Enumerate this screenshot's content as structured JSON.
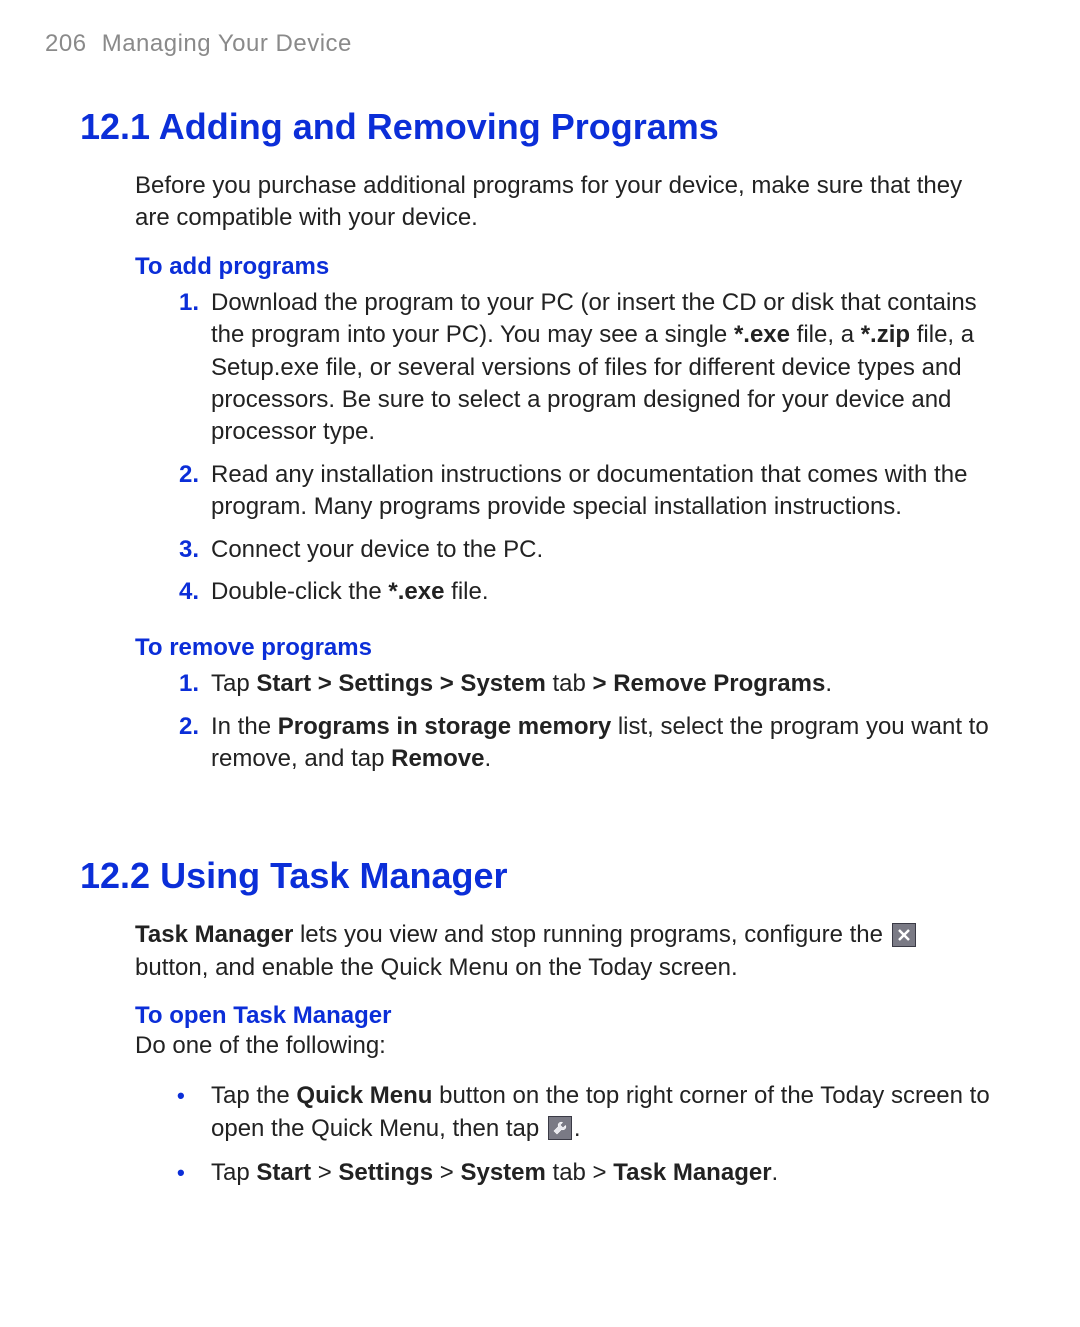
{
  "header": {
    "page_number": "206",
    "running_title": "Managing Your Device"
  },
  "section_12_1": {
    "heading": "12.1  Adding and Removing Programs",
    "intro": "Before you purchase additional programs for your device, make sure that they are compatible with your device.",
    "add": {
      "subhead": "To add programs",
      "steps": {
        "s1_a": "Download the program to your PC (or insert the CD or disk that contains the program into your PC). You may see a single ",
        "s1_b": "*.exe",
        "s1_c": " file, a ",
        "s1_d": "*.zip",
        "s1_e": " file, a Setup.exe file, or several versions of files for different device types and processors. Be sure to select a program designed for your device and processor type.",
        "s2": "Read any installation instructions or documentation that comes with the program. Many programs provide special installation instructions.",
        "s3": "Connect your device to the PC.",
        "s4_a": "Double-click the ",
        "s4_b": "*.exe",
        "s4_c": " file."
      }
    },
    "remove": {
      "subhead": "To remove programs",
      "steps": {
        "s1_a": "Tap ",
        "s1_b": "Start > Settings > System",
        "s1_c": " tab ",
        "s1_d": "> Remove Programs",
        "s1_e": ".",
        "s2_a": "In the ",
        "s2_b": "Programs in storage memory",
        "s2_c": " list, select the program you want to remove, and tap ",
        "s2_d": "Remove",
        "s2_e": "."
      }
    }
  },
  "section_12_2": {
    "heading": "12.2  Using Task Manager",
    "intro": {
      "a": "Task Manager",
      "b": " lets you view and stop running programs, configure the ",
      "c": " button, and enable the Quick Menu on the Today screen."
    },
    "open": {
      "subhead": "To open Task Manager",
      "lead": "Do one of the following:",
      "bullets": {
        "b1_a": "Tap the ",
        "b1_b": "Quick Menu",
        "b1_c": " button on the top right corner of the Today screen to open the Quick Menu, then tap ",
        "b1_d": ".",
        "b2_a": "Tap ",
        "b2_b": "Start",
        "b2_gt1": " > ",
        "b2_c": "Settings",
        "b2_gt2": " > ",
        "b2_d": "System",
        "b2_e": " tab > ",
        "b2_f": "Task Manager",
        "b2_g": "."
      }
    }
  },
  "numbers": {
    "n1": "1.",
    "n2": "2.",
    "n3": "3.",
    "n4": "4."
  },
  "bullet_char": "•",
  "icons": {
    "close": "close-icon",
    "wrench": "wrench-icon"
  }
}
